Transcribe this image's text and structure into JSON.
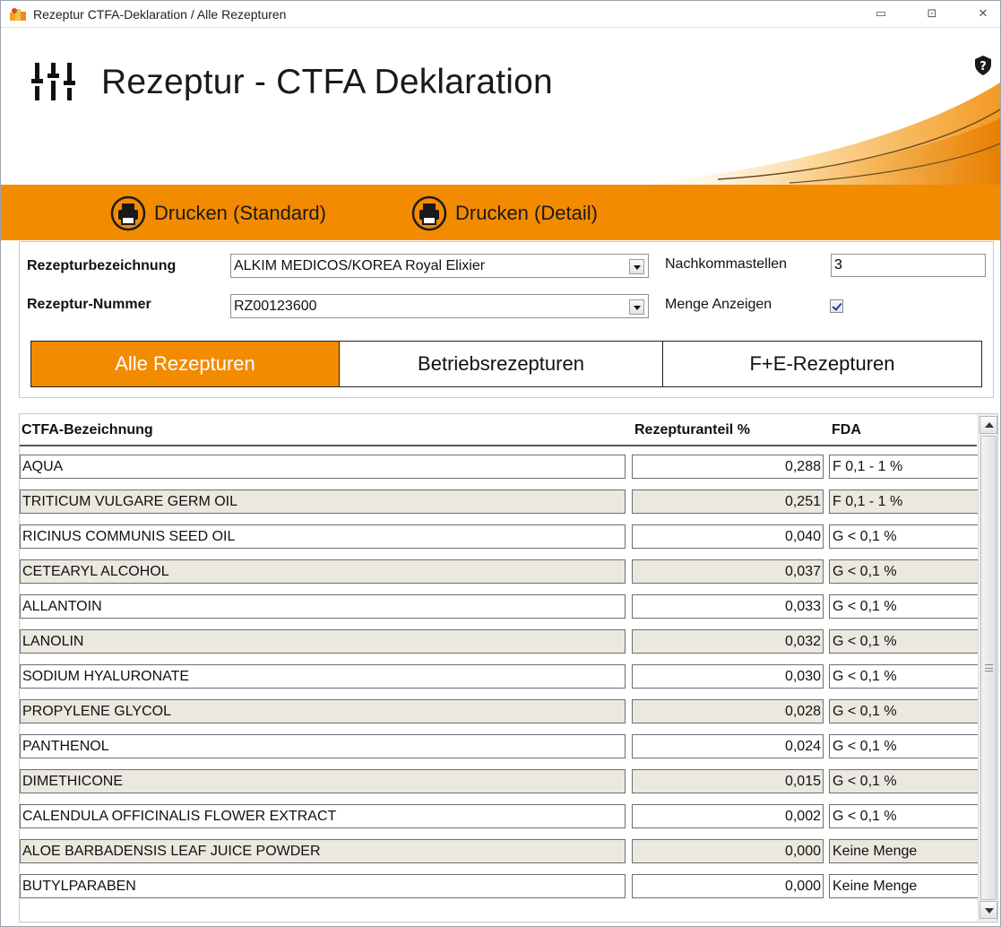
{
  "window": {
    "title": "Rezeptur CTFA-Deklaration / Alle Rezepturen",
    "controls": {
      "minimize": "▭",
      "maximize": "⊡",
      "close": "✕"
    }
  },
  "header": {
    "title": "Rezeptur - CTFA Deklaration",
    "icon": "mixer-sliders-icon",
    "help_icon": "shield-question-icon"
  },
  "toolbar": {
    "print_standard": "Drucken (Standard)",
    "print_detail": "Drucken (Detail)",
    "icon": "printer-icon"
  },
  "form": {
    "name_label": "Rezepturbezeichnung",
    "name_value": "ALKIM MEDICOS/KOREA Royal Elixier",
    "number_label": "Rezeptur-Nummer",
    "number_value": "RZ00123600",
    "decimals_label": "Nachkommastellen",
    "decimals_value": "3",
    "show_amount_label": "Menge Anzeigen",
    "show_amount_checked": true
  },
  "tabs": [
    {
      "label": "Alle Rezepturen",
      "active": true
    },
    {
      "label": "Betriebsrezepturen",
      "active": false
    },
    {
      "label": "F+E-Rezepturen",
      "active": false
    }
  ],
  "grid": {
    "columns": {
      "name": "CTFA-Bezeichnung",
      "pct": "Rezepturanteil %",
      "fda": "FDA"
    },
    "rows": [
      {
        "name": "AQUA",
        "pct": "0,288",
        "fda": "F 0,1 - 1 %"
      },
      {
        "name": "TRITICUM VULGARE GERM OIL",
        "pct": "0,251",
        "fda": "F 0,1 - 1 %"
      },
      {
        "name": "RICINUS COMMUNIS SEED OIL",
        "pct": "0,040",
        "fda": "G < 0,1 %"
      },
      {
        "name": "CETEARYL ALCOHOL",
        "pct": "0,037",
        "fda": "G < 0,1 %"
      },
      {
        "name": "ALLANTOIN",
        "pct": "0,033",
        "fda": "G < 0,1 %"
      },
      {
        "name": "LANOLIN",
        "pct": "0,032",
        "fda": "G < 0,1 %"
      },
      {
        "name": "SODIUM HYALURONATE",
        "pct": "0,030",
        "fda": "G < 0,1 %"
      },
      {
        "name": "PROPYLENE GLYCOL",
        "pct": "0,028",
        "fda": "G < 0,1 %"
      },
      {
        "name": "PANTHENOL",
        "pct": "0,024",
        "fda": "G < 0,1 %"
      },
      {
        "name": "DIMETHICONE",
        "pct": "0,015",
        "fda": "G < 0,1 %"
      },
      {
        "name": "CALENDULA OFFICINALIS FLOWER EXTRACT",
        "pct": "0,002",
        "fda": "G < 0,1 %"
      },
      {
        "name": "ALOE BARBADENSIS LEAF JUICE POWDER",
        "pct": "0,000",
        "fda": "Keine Menge"
      },
      {
        "name": "BUTYLPARABEN",
        "pct": "0,000",
        "fda": "Keine Menge"
      }
    ]
  },
  "colors": {
    "accent": "#f28b00",
    "row_alt": "#ebe8e0"
  }
}
